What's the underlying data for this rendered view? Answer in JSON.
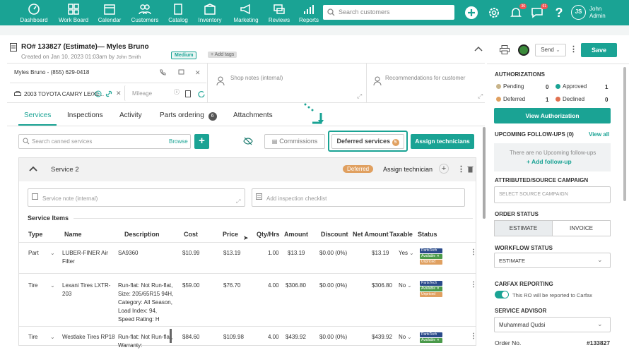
{
  "nav": {
    "items": [
      {
        "label": "Dashboard",
        "icon": "dashboard-icon"
      },
      {
        "label": "Work Board",
        "icon": "work-board-icon"
      },
      {
        "label": "Calendar",
        "icon": "calendar-icon"
      },
      {
        "label": "Customers",
        "icon": "customers-icon"
      },
      {
        "label": "Catalog",
        "icon": "catalog-icon"
      },
      {
        "label": "Inventory",
        "icon": "inventory-icon"
      },
      {
        "label": "Marketing",
        "icon": "marketing-icon"
      },
      {
        "label": "Reviews",
        "icon": "reviews-icon"
      },
      {
        "label": "Reports",
        "icon": "reports-icon"
      }
    ],
    "search_placeholder": "Search customers",
    "notif_badge": "36",
    "chat_badge": "61",
    "avatar": "JS",
    "user_first": "John",
    "user_last": "Admin"
  },
  "ro": {
    "title": "RO# 133827 (Estimate)— Myles Bruno",
    "created": "Created on Jan 10, 2023 01:03am by",
    "created_by": "John Smith",
    "priority": "Medium",
    "add_tags": "+ Add tags",
    "customer": "Myles Bruno - (855) 629-0418",
    "vehicle": "2003 TOYOTA CAMRY LE/XL...",
    "mileage_placeholder": "Mileage",
    "shop_notes_placeholder": "Shop notes (internal)",
    "recommendations_placeholder": "Recommendations for customer"
  },
  "tabs": [
    {
      "label": "Services"
    },
    {
      "label": "Inspections"
    },
    {
      "label": "Activity"
    },
    {
      "label": "Parts ordering",
      "count": "6"
    },
    {
      "label": "Attachments"
    }
  ],
  "toolbar": {
    "canned_placeholder": "Search canned services",
    "browse": "Browse",
    "commissions": "Commissions",
    "deferred": "Deferred services",
    "deferred_count": "5",
    "assign": "Assign technicians"
  },
  "service": {
    "name": "Service 2",
    "status": "Deferred",
    "assign": "Assign technician",
    "note_placeholder": "Service note (internal)",
    "checklist_placeholder": "Add inspection checklist",
    "items_title": "Service Items"
  },
  "table": {
    "headers": [
      "Type",
      "Name",
      "Description",
      "Cost",
      "Price",
      "Qty/Hrs",
      "Amount",
      "Discount",
      "Net Amount",
      "Taxable",
      "Status"
    ],
    "rows": [
      {
        "type": "Part",
        "name": "LUBER-FINER Air Filter",
        "desc": "SA9360",
        "cost": "$10.99",
        "price": "$13.19",
        "qty": "1.00",
        "amount": "$13.19",
        "discount": "$0.00 (0%)",
        "net": "$13.19",
        "taxable": "Yes"
      },
      {
        "type": "Tire",
        "name": "Lexani Tires LXTR-203",
        "desc": "Run-flat: Not Run-flat, Size: 205/65R15 94H, Category: All Season, Load Index: 94, Speed Rating: H",
        "cost": "$59.00",
        "price": "$76.70",
        "qty": "4.00",
        "amount": "$306.80",
        "discount": "$0.00 (0%)",
        "net": "$306.80",
        "taxable": "No"
      },
      {
        "type": "Tire",
        "name": "Westlake Tires RP18",
        "desc": "Run-flat: Not Run-flat, Warranty:",
        "cost": "$84.60",
        "price": "$109.98",
        "qty": "4.00",
        "amount": "$439.92",
        "discount": "$0.00 (0%)",
        "net": "$439.92",
        "taxable": "No"
      }
    ],
    "status_tags": {
      "source": "PartsTech",
      "avail": "Available ✕",
      "avail2": "Unpriced"
    }
  },
  "header_actions": {
    "send": "Send",
    "save": "Save"
  },
  "sidebar": {
    "authorizations_title": "AUTHORIZATIONS",
    "pending": "Pending",
    "pending_count": "0",
    "approved": "Approved",
    "approved_count": "1",
    "deferred": "Deferred",
    "deferred_count": "1",
    "declined": "Declined",
    "declined_count": "0",
    "view_auth": "View Authorization",
    "followups_title": "UPCOMING FOLLOW-UPS (0)",
    "view_all": "View all",
    "no_followups": "There are no Upcoming follow-ups",
    "add_followup": "+ Add follow-up",
    "campaign_title": "ATTRIBUTED/SOURCE CAMPAIGN",
    "campaign_placeholder": "SELECT SOURCE CAMPAIGN",
    "order_status_title": "ORDER STATUS",
    "estimate": "ESTIMATE",
    "invoice": "INVOICE",
    "workflow_title": "WORKFLOW STATUS",
    "workflow_value": "ESTIMATE",
    "carfax_title": "CARFAX REPORTING",
    "carfax_text": "This RO will be reported to Carfax",
    "advisor_title": "SERVICE ADVISOR",
    "advisor_value": "Muhammad Qudsi",
    "order_no_label": "Order No.",
    "order_no": "#133827"
  },
  "colors": {
    "brand": "#1aa394",
    "deferred": "#e0a060",
    "approved": "#1aa394",
    "pending": "#c8b48a",
    "declined": "#e07050",
    "highlight": "#1aa394"
  }
}
